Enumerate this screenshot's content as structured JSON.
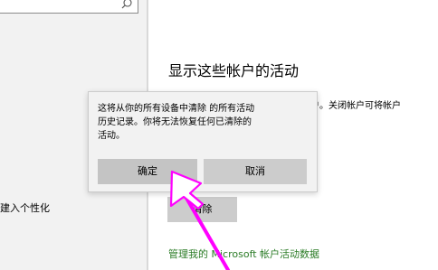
{
  "sidebar": {
    "search_icon": "search-icon",
    "item_label": "建入个性化"
  },
  "main": {
    "section_title": "显示这些帐户的活动",
    "description": "户。关闭帐户可将帐户",
    "clear_button": "清除",
    "manage_link": "管理我的 Microsoft 帐户活动数据"
  },
  "flyout": {
    "message_lines": [
      "这将从你的所有设备中清除  的所有活动",
      "历史记录。你将无法恢复任何已清除的",
      "活动。"
    ],
    "confirm_label": "确定",
    "cancel_label": "取消"
  },
  "colors": {
    "link": "#2a7b25",
    "annotation_arrow": "#ff00ff",
    "button_bg": "#cccccc",
    "flyout_bg": "#f2f2f2"
  }
}
